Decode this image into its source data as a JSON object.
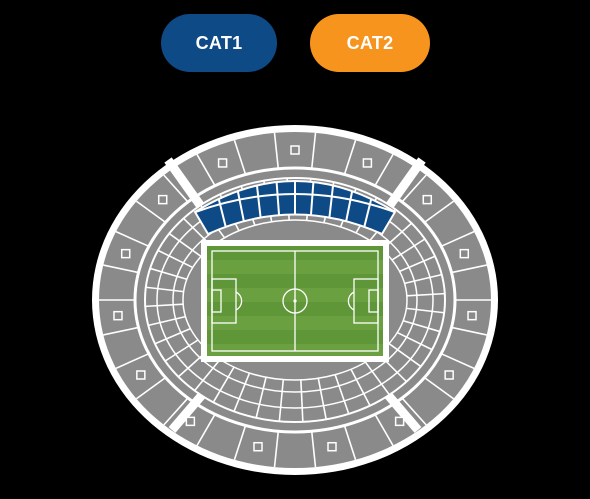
{
  "legend": [
    {
      "label": "CAT1",
      "color": "#0e4a86"
    },
    {
      "label": "CAT2",
      "color": "#f7941d"
    }
  ],
  "colors": {
    "background": "#000000",
    "stand": "#8a8a8a",
    "lines": "#ffffff",
    "pitch": "#6aa040",
    "pitch_stripe": "#5f9638",
    "cat1_section": "#0e4a86"
  },
  "map": {
    "type": "stadium-seating-map",
    "highlighted_sections": [
      "cat1-upper-long-side"
    ]
  }
}
